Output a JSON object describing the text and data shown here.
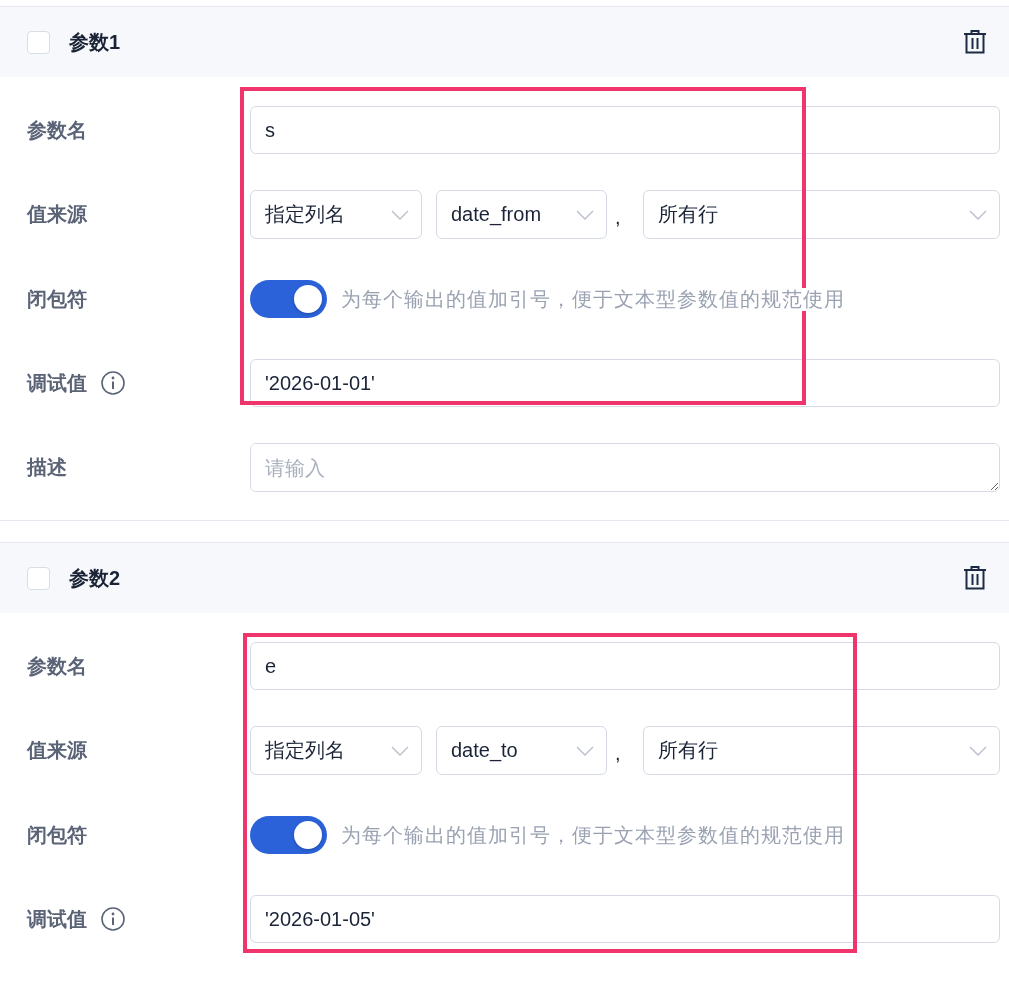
{
  "params": [
    {
      "title": "参数1",
      "checked": false,
      "highlighted": true,
      "rows": [
        {
          "kind": "text",
          "label": "参数名",
          "value": "s"
        },
        {
          "kind": "source",
          "label": "值来源",
          "source_type": "指定列名",
          "column": "date_from",
          "separator": ",",
          "scope": "所有行"
        },
        {
          "kind": "switch",
          "label": "闭包符",
          "on": true,
          "hint": "为每个输出的值加引号，便于文本型参数值的规范使用"
        },
        {
          "kind": "text",
          "label": "调试值",
          "info": true,
          "value": "'2026-01-01'"
        },
        {
          "kind": "textarea",
          "label": "描述",
          "placeholder": "请输入"
        }
      ]
    },
    {
      "title": "参数2",
      "checked": false,
      "highlighted": true,
      "rows": [
        {
          "kind": "text",
          "label": "参数名",
          "value": "e"
        },
        {
          "kind": "source",
          "label": "值来源",
          "source_type": "指定列名",
          "column": "date_to",
          "separator": ",",
          "scope": "所有行"
        },
        {
          "kind": "switch",
          "label": "闭包符",
          "on": true,
          "hint": "为每个输出的值加引号，便于文本型参数值的规范使用"
        },
        {
          "kind": "text",
          "label": "调试值",
          "info": true,
          "value": "'2026-01-05'"
        }
      ]
    }
  ]
}
